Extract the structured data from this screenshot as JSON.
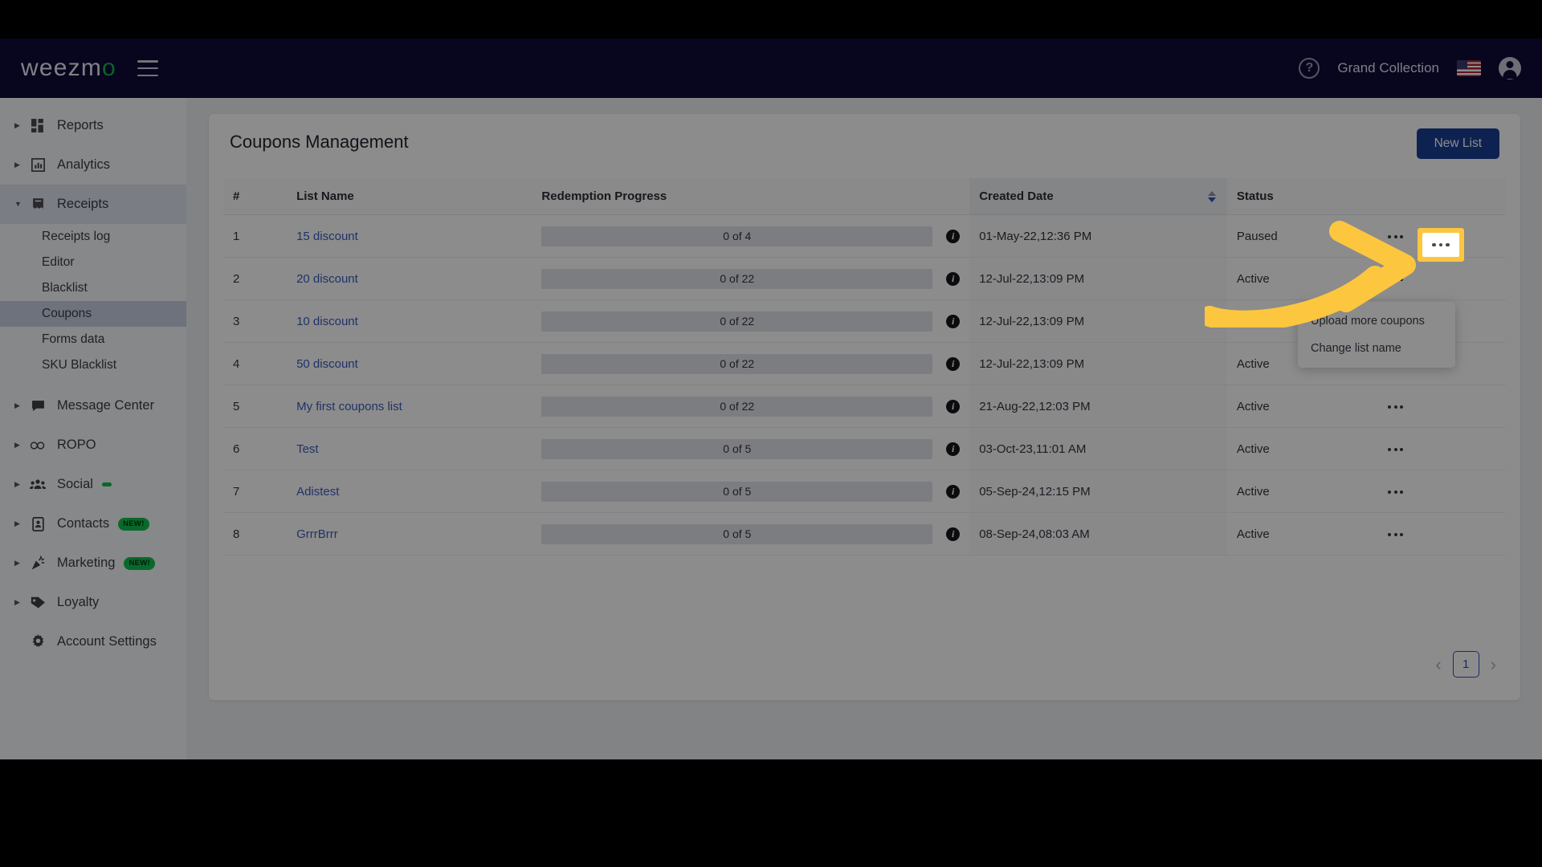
{
  "topbar": {
    "logo_main": "weezm",
    "logo_accent": "o",
    "menu_icon": "hamburger-icon",
    "help_icon": "?",
    "account_name": "Grand Collection",
    "flag_icon": "us-flag-icon",
    "avatar_icon": "account-circle-icon"
  },
  "sidebar": {
    "items": [
      {
        "label": "Reports",
        "icon": "dashboard-icon",
        "expandable": true,
        "badge": ""
      },
      {
        "label": "Analytics",
        "icon": "bar-chart-icon",
        "expandable": true,
        "badge": ""
      },
      {
        "label": "Receipts",
        "icon": "receipt-icon",
        "expandable": true,
        "expanded": true,
        "badge": ""
      },
      {
        "label": "Message Center",
        "icon": "chat-bubble-icon",
        "expandable": true,
        "badge": ""
      },
      {
        "label": "ROPO",
        "icon": "infinity-icon",
        "expandable": true,
        "badge": ""
      },
      {
        "label": "Social",
        "icon": "people-group-icon",
        "expandable": true,
        "badge": ""
      },
      {
        "label": "Contacts",
        "icon": "contact-card-icon",
        "expandable": true,
        "badge": "NEW!"
      },
      {
        "label": "Marketing",
        "icon": "party-popper-icon",
        "expandable": true,
        "badge": "NEW!"
      },
      {
        "label": "Loyalty",
        "icon": "tag-icon",
        "expandable": true,
        "badge": ""
      },
      {
        "label": "Account Settings",
        "icon": "gear-icon",
        "expandable": false,
        "badge": ""
      }
    ],
    "receipts_subitems": [
      {
        "label": "Receipts log",
        "active": false
      },
      {
        "label": "Editor",
        "active": false
      },
      {
        "label": "Blacklist",
        "active": false
      },
      {
        "label": "Coupons",
        "active": true
      },
      {
        "label": "Forms data",
        "active": false
      },
      {
        "label": "SKU Blacklist",
        "active": false
      }
    ]
  },
  "main": {
    "title": "Coupons Management",
    "new_list_label": "New List",
    "columns": [
      "#",
      "List Name",
      "Redemption Progress",
      "Created Date",
      "Status",
      ""
    ],
    "sortable_column": "Created Date",
    "rows": [
      {
        "idx": "1",
        "name": "15 discount",
        "progress": "0 of 4",
        "redeemed": 0,
        "total": 4,
        "date": "01-May-22,12:36 PM",
        "status": "Paused"
      },
      {
        "idx": "2",
        "name": "20 discount",
        "progress": "0 of 22",
        "redeemed": 0,
        "total": 22,
        "date": "12-Jul-22,13:09 PM",
        "status": "Active"
      },
      {
        "idx": "3",
        "name": "10 discount",
        "progress": "0 of 22",
        "redeemed": 0,
        "total": 22,
        "date": "12-Jul-22,13:09 PM",
        "status": "Active"
      },
      {
        "idx": "4",
        "name": "50 discount",
        "progress": "0 of 22",
        "redeemed": 0,
        "total": 22,
        "date": "12-Jul-22,13:09 PM",
        "status": "Active"
      },
      {
        "idx": "5",
        "name": "My first coupons list",
        "progress": "0 of 22",
        "redeemed": 0,
        "total": 22,
        "date": "21-Aug-22,12:03 PM",
        "status": "Active"
      },
      {
        "idx": "6",
        "name": "Test",
        "progress": "0 of 5",
        "redeemed": 0,
        "total": 5,
        "date": "03-Oct-23,11:01 AM",
        "status": "Active"
      },
      {
        "idx": "7",
        "name": "Adistest",
        "progress": "0 of 5",
        "redeemed": 0,
        "total": 5,
        "date": "05-Sep-24,12:15 PM",
        "status": "Active"
      },
      {
        "idx": "8",
        "name": "GrrrBrrr",
        "progress": "0 of 5",
        "redeemed": 0,
        "total": 5,
        "date": "08-Sep-24,08:03 AM",
        "status": "Active"
      }
    ],
    "pagination": {
      "prev": "‹",
      "page": "1",
      "next": "›"
    }
  },
  "dropdown": {
    "items": [
      "Upload more coupons",
      "Change list name"
    ]
  },
  "highlight": {
    "target": "row-actions-menu-button",
    "color": "#fcc63f",
    "arrow_icon": "curved-arrow-right-icon"
  }
}
